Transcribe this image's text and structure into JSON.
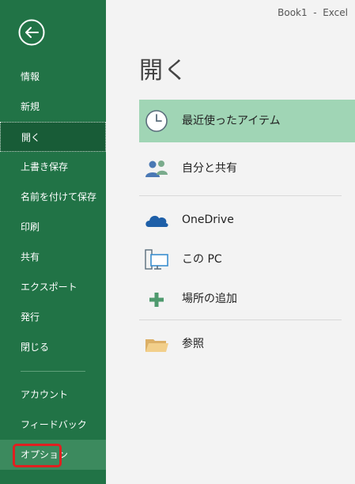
{
  "window": {
    "title": "Book1  -  Excel"
  },
  "page": {
    "title": "開く"
  },
  "sidebar": {
    "back_icon": "back-arrow-icon",
    "items": [
      {
        "label": "情報"
      },
      {
        "label": "新規"
      },
      {
        "label": "開く"
      },
      {
        "label": "上書き保存"
      },
      {
        "label": "名前を付けて保存"
      },
      {
        "label": "印刷"
      },
      {
        "label": "共有"
      },
      {
        "label": "エクスポート"
      },
      {
        "label": "発行"
      },
      {
        "label": "閉じる"
      },
      {
        "label": "アカウント"
      },
      {
        "label": "フィードバック"
      },
      {
        "label": "オプション"
      }
    ],
    "selected_item": "開く",
    "highlighted_item": "オプション"
  },
  "open_locations": [
    {
      "label": "最近使ったアイテム",
      "icon": "clock-icon"
    },
    {
      "label": "自分と共有",
      "icon": "shared-people-icon"
    },
    {
      "label": "OneDrive",
      "icon": "onedrive-cloud-icon"
    },
    {
      "label": "この PC",
      "icon": "computer-icon"
    },
    {
      "label": "場所の追加",
      "icon": "add-plus-icon"
    },
    {
      "label": "参照",
      "icon": "folder-icon"
    }
  ],
  "colors": {
    "sidebar": "#217346",
    "selected_nav": "#185c37",
    "selected_location": "#a0d5b5",
    "highlight_border": "#e02020"
  }
}
